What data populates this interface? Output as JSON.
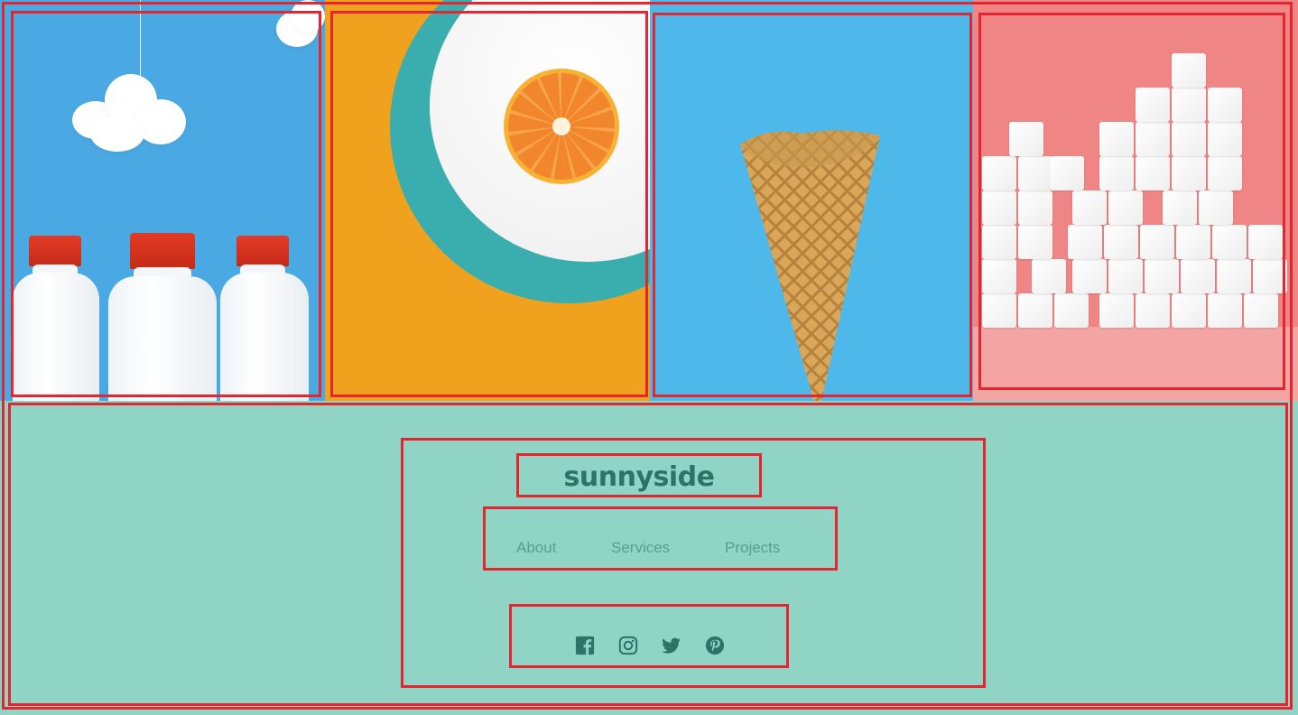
{
  "brand": {
    "logo": "sunnyside"
  },
  "footer": {
    "nav": [
      {
        "label": "About"
      },
      {
        "label": "Services"
      },
      {
        "label": "Projects"
      }
    ],
    "social": [
      {
        "icon": "facebook-icon"
      },
      {
        "icon": "instagram-icon"
      },
      {
        "icon": "twitter-icon"
      },
      {
        "icon": "pinterest-icon"
      }
    ],
    "colors": {
      "background": "#90d4c5",
      "logo": "#2c7566",
      "link": "#5a9e8e"
    }
  },
  "gallery": {
    "images": [
      {
        "subject": "milk-bottles",
        "background": "#4aa9e3"
      },
      {
        "subject": "orange",
        "background": "#f0a11e"
      },
      {
        "subject": "cone",
        "background": "#4fb8ea"
      },
      {
        "subject": "sugar-cubes",
        "background": "#f08585"
      }
    ]
  }
}
